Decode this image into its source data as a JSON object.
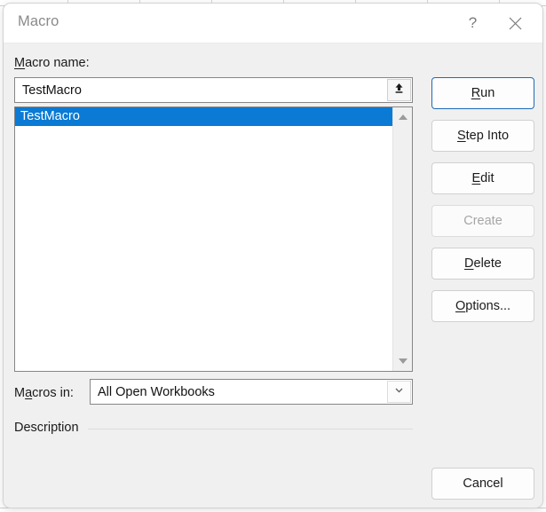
{
  "backdrop": {
    "app": "spreadsheet-grid"
  },
  "dialog": {
    "title": "Macro",
    "titlebar": {
      "help_label": "?",
      "help_icon": "question-mark-icon",
      "close_icon": "close-icon"
    },
    "macro_name": {
      "label_pre": "M",
      "label_accel": "",
      "label_post": "acro name:",
      "label_full": "Macro name:",
      "value": "TestMacro",
      "placeholder": "",
      "upload_icon": "upload-arrow-icon"
    },
    "macro_list": {
      "items": [
        {
          "label": "TestMacro",
          "selected": true
        }
      ],
      "scrollbar": {
        "up_icon": "triangle-up-icon",
        "down_icon": "triangle-down-icon"
      }
    },
    "macros_in": {
      "label_full": "Macros in:",
      "label_a": "M",
      "label_b": "a",
      "label_c": "cros in:",
      "value": "All Open Workbooks",
      "options": [
        "All Open Workbooks"
      ],
      "dropdown_icon": "chevron-down-icon"
    },
    "description": {
      "label": "Description",
      "text": ""
    },
    "buttons": [
      {
        "name": "run",
        "label": "Run",
        "accel": "R",
        "pre": "",
        "post": "un",
        "state": "default"
      },
      {
        "name": "step-into",
        "label": "Step Into",
        "accel": "S",
        "pre": "",
        "post": "tep Into",
        "state": "normal"
      },
      {
        "name": "edit",
        "label": "Edit",
        "accel": "E",
        "pre": "",
        "post": "dit",
        "state": "normal"
      },
      {
        "name": "create",
        "label": "Create",
        "accel": "",
        "pre": "Create",
        "post": "",
        "state": "disabled"
      },
      {
        "name": "delete",
        "label": "Delete",
        "accel": "D",
        "pre": "",
        "post": "elete",
        "state": "normal"
      },
      {
        "name": "options",
        "label": "Options...",
        "accel": "O",
        "pre": "",
        "post": "ptions...",
        "state": "normal"
      },
      {
        "name": "cancel",
        "label": "Cancel",
        "accel": "",
        "pre": "Cancel",
        "post": "",
        "state": "normal"
      }
    ],
    "colors": {
      "selection_blue": "#0a7ad4",
      "default_button_border": "#1d6ab5",
      "dialog_background": "#f0f0f0",
      "titlebar_background": "#ffffff",
      "title_text": "#8a8a8a"
    }
  }
}
